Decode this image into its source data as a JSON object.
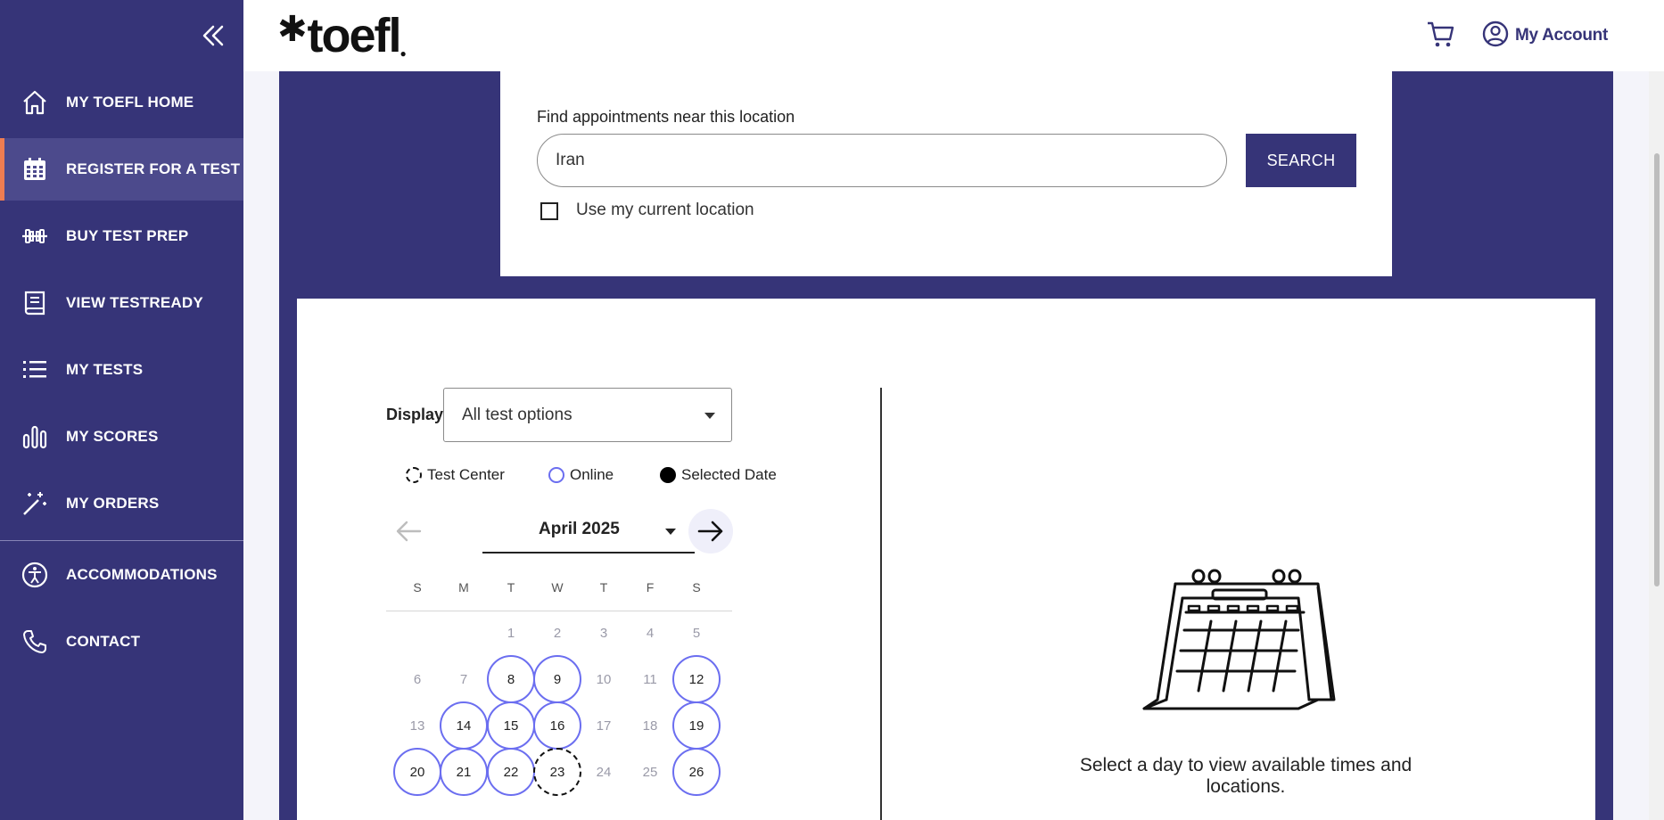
{
  "sidebar": {
    "items": [
      {
        "label": "MY TOEFL HOME",
        "icon": "home-icon",
        "active": false
      },
      {
        "label": "REGISTER FOR A TEST",
        "icon": "calendar-icon",
        "active": true
      },
      {
        "label": "BUY TEST PREP",
        "icon": "dumbbell-icon",
        "active": false
      },
      {
        "label": "VIEW TESTREADY",
        "icon": "book-icon",
        "active": false
      },
      {
        "label": "MY TESTS",
        "icon": "list-icon",
        "active": false
      },
      {
        "label": "MY SCORES",
        "icon": "bar-chart-icon",
        "active": false
      },
      {
        "label": "MY ORDERS",
        "icon": "magic-wand-icon",
        "active": false
      },
      {
        "label": "ACCOMMODATIONS",
        "icon": "accessibility-icon",
        "active": false
      },
      {
        "label": "CONTACT",
        "icon": "phone-icon",
        "active": false
      }
    ],
    "colors": {
      "background": "#363478",
      "active_bg": "#4c4a8c",
      "active_accent": "#ef7d52"
    }
  },
  "header": {
    "logo_text": "toefl",
    "account_label": "My Account"
  },
  "search": {
    "label": "Find appointments near this location",
    "location_value": "Iran",
    "button_label": "SEARCH",
    "current_location_label": "Use my current location"
  },
  "calendar": {
    "display_label": "Display",
    "display_value": "All test options",
    "legend": {
      "test_center": "Test Center",
      "online": "Online",
      "selected": "Selected Date"
    },
    "month": "April 2025",
    "days_of_week": [
      "S",
      "M",
      "T",
      "W",
      "T",
      "F",
      "S"
    ],
    "weeks": [
      [
        null,
        null,
        {
          "d": "1",
          "t": "disabled"
        },
        {
          "d": "2",
          "t": "disabled"
        },
        {
          "d": "3",
          "t": "disabled"
        },
        {
          "d": "4",
          "t": "disabled"
        },
        {
          "d": "5",
          "t": "disabled"
        }
      ],
      [
        {
          "d": "6",
          "t": "disabled"
        },
        {
          "d": "7",
          "t": "disabled"
        },
        {
          "d": "8",
          "t": "online"
        },
        {
          "d": "9",
          "t": "online"
        },
        {
          "d": "10",
          "t": "disabled"
        },
        {
          "d": "11",
          "t": "disabled"
        },
        {
          "d": "12",
          "t": "online"
        }
      ],
      [
        {
          "d": "13",
          "t": "disabled"
        },
        {
          "d": "14",
          "t": "online"
        },
        {
          "d": "15",
          "t": "online"
        },
        {
          "d": "16",
          "t": "online"
        },
        {
          "d": "17",
          "t": "disabled"
        },
        {
          "d": "18",
          "t": "disabled"
        },
        {
          "d": "19",
          "t": "online"
        }
      ],
      [
        {
          "d": "20",
          "t": "online"
        },
        {
          "d": "21",
          "t": "online"
        },
        {
          "d": "22",
          "t": "online"
        },
        {
          "d": "23",
          "t": "center"
        },
        {
          "d": "24",
          "t": "disabled"
        },
        {
          "d": "25",
          "t": "disabled"
        },
        {
          "d": "26",
          "t": "online"
        }
      ]
    ],
    "empty_message": "Select a day to view available times and locations.",
    "colors": {
      "online_ring": "#6b6ef0",
      "brand": "#363478"
    }
  }
}
